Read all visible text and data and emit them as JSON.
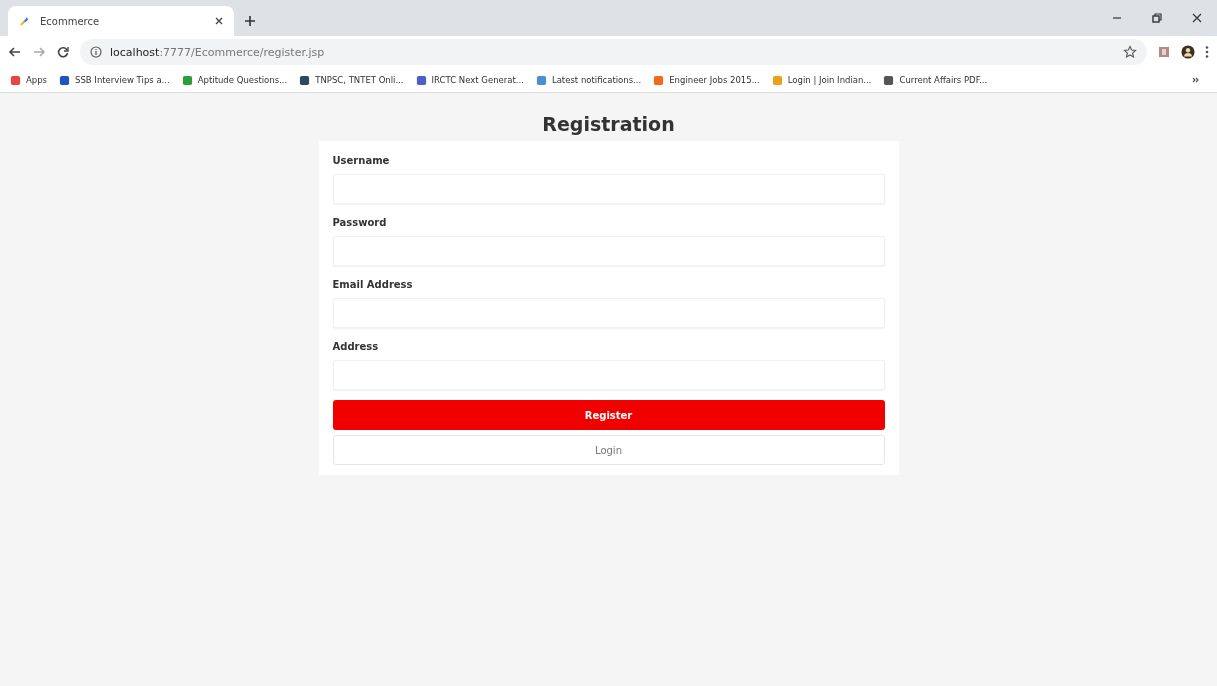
{
  "browser": {
    "tab": {
      "title": "Ecommerce"
    },
    "url": {
      "host": "localhost",
      "path": ":7777/Ecommerce/register.jsp"
    },
    "bookmarks": [
      {
        "label": "Apps",
        "color": "#e8453c"
      },
      {
        "label": "SSB Interview Tips a...",
        "color": "#1a56c4"
      },
      {
        "label": "Aptitude Questions...",
        "color": "#2e9e3a"
      },
      {
        "label": "TNPSC, TNTET Onli...",
        "color": "#33475b"
      },
      {
        "label": "IRCTC Next Generat...",
        "color": "#4b5fc9"
      },
      {
        "label": "Latest notifications...",
        "color": "#4a8fd6"
      },
      {
        "label": "Engineer Jobs 2015...",
        "color": "#f26a1b"
      },
      {
        "label": "Login | Join Indian...",
        "color": "#e6a21a"
      },
      {
        "label": "Current Affairs PDF...",
        "color": "#555555"
      }
    ]
  },
  "page": {
    "title": "Registration",
    "fields": [
      {
        "label": "Username"
      },
      {
        "label": "Password"
      },
      {
        "label": "Email Address"
      },
      {
        "label": "Address"
      }
    ],
    "buttons": [
      {
        "label": "Register",
        "kind": "primary"
      },
      {
        "label": "Login",
        "kind": "secondary"
      }
    ]
  }
}
